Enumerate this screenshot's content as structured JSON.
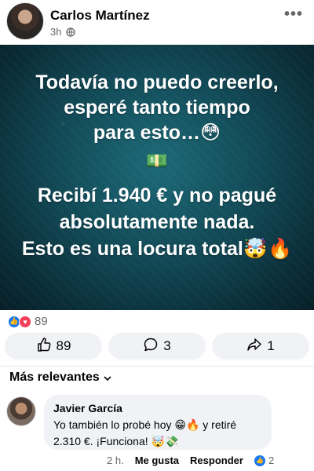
{
  "post": {
    "author": "Carlos Martínez",
    "time": "3h",
    "privacy_icon": "globe-icon",
    "more_label": "•••",
    "image_text": {
      "line1": "Todavía no puedo creerlo,",
      "line2": "esperé tanto tiempo",
      "line3": "para esto…😳",
      "line4": "💵",
      "line5": "Recibí 1.940 € y no pagué",
      "line6": "absolutamente nada.",
      "line7": "Esto es una locura total🤯🔥"
    },
    "reactions": {
      "icons": [
        "like-icon",
        "love-icon"
      ],
      "count": "89"
    },
    "actions": {
      "like_count": "89",
      "comment_count": "3",
      "share_count": "1"
    }
  },
  "comments_section": {
    "filter_label": "Más relevantes",
    "comment": {
      "author": "Javier García",
      "text": "Yo también lo probé hoy 😁🔥 y retiré 2.310 €. ¡Funciona! 🤯💸",
      "time": "2 h.",
      "like_label": "Me gusta",
      "reply_label": "Responder",
      "reaction_count": "2"
    }
  },
  "colors": {
    "accent": "#1877f2",
    "love": "#f33e58",
    "button_bg": "#f0f2f5",
    "secondary_text": "#65676b"
  }
}
